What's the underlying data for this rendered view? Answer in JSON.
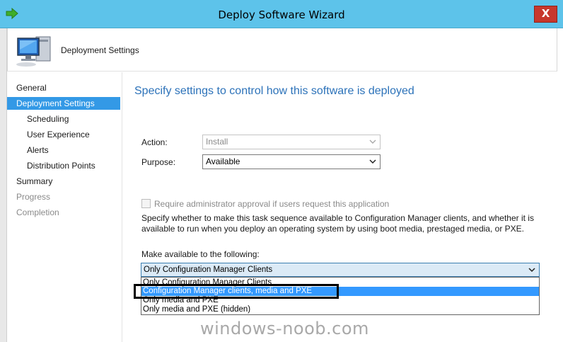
{
  "window": {
    "title": "Deploy Software Wizard",
    "close_label": "X"
  },
  "header": {
    "title": "Deployment Settings"
  },
  "nav": {
    "items": [
      {
        "label": "General",
        "state": "normal"
      },
      {
        "label": "Deployment Settings",
        "state": "active"
      },
      {
        "label": "Scheduling",
        "state": "sub"
      },
      {
        "label": "User Experience",
        "state": "sub"
      },
      {
        "label": "Alerts",
        "state": "sub"
      },
      {
        "label": "Distribution Points",
        "state": "sub"
      },
      {
        "label": "Summary",
        "state": "normal"
      },
      {
        "label": "Progress",
        "state": "disabled"
      },
      {
        "label": "Completion",
        "state": "disabled"
      }
    ]
  },
  "content": {
    "heading": "Specify settings to control how this software is deployed",
    "action": {
      "label": "Action:",
      "value": "Install"
    },
    "purpose": {
      "label": "Purpose:",
      "value": "Available"
    },
    "approval": {
      "label": "Require administrator approval if users request this application",
      "checked": false
    },
    "description": "Specify whether to make this task sequence available to Configuration Manager clients, and whether it is available to run when you deploy an operating system by using boot media, prestaged media, or PXE.",
    "make_available": {
      "label": "Make available to the following:",
      "value": "Only Configuration Manager Clients",
      "options": [
        "Only Configuration Manager Clients",
        "Configuration Manager clients, media and PXE",
        "Only media and PXE",
        "Only media and PXE (hidden)"
      ],
      "highlighted_index": 1
    }
  },
  "watermark": "windows-noob.com",
  "colors": {
    "titlebar": "#5dc3ea",
    "accent": "#3399e6",
    "heading": "#2c72b9",
    "close": "#c7372c"
  }
}
